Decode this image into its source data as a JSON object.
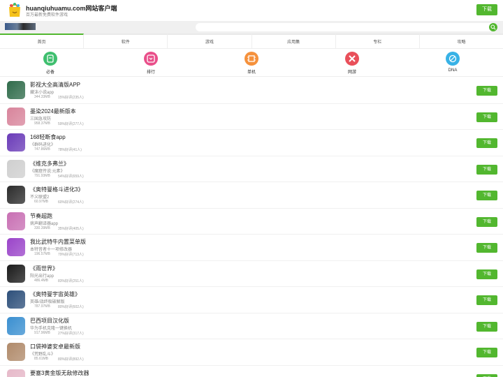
{
  "header": {
    "title": "huanqiuhuamu.com网站客户端",
    "subtitle": "百万最新免费软件游戏",
    "download_label": "下载"
  },
  "search": {
    "placeholder": ""
  },
  "tabs": [
    {
      "label": "首页"
    },
    {
      "label": "软件"
    },
    {
      "label": "游戏"
    },
    {
      "label": "应用集"
    },
    {
      "label": "专栏"
    },
    {
      "label": "攻略"
    }
  ],
  "categories": [
    {
      "label": "必备",
      "icon": "box-icon",
      "color": "#3fbf6f"
    },
    {
      "label": "排行",
      "icon": "rank-icon",
      "color": "#e94f8a"
    },
    {
      "label": "单机",
      "icon": "chip-icon",
      "color": "#f5913c"
    },
    {
      "label": "网游",
      "icon": "cross-icon",
      "color": "#e9505a"
    },
    {
      "label": "DNA",
      "icon": "dna-icon",
      "color": "#38b2e6"
    }
  ],
  "apps": [
    {
      "name": "影视大全高清版APP",
      "desc": "藏沫小说app",
      "size": "344.33MB",
      "rating": "15%好评(235人)",
      "color": "#2f6b4a",
      "download": "下载"
    },
    {
      "name": "墨染2024最新版本",
      "desc": "三国急攻防",
      "size": "958.37MB",
      "rating": "59%好评(277人)",
      "color": "#d8849b",
      "download": "下载"
    },
    {
      "name": "168轻断食app",
      "desc": "《群码进化》",
      "size": "747.86MB",
      "rating": "78%好评(41人)",
      "color": "#6a3bb8",
      "download": "下载"
    },
    {
      "name": "《维克多弗兰》",
      "desc": "《魔窟传说:元素》",
      "size": "791.93MB",
      "rating": "54%好评(659人)",
      "color": "#cfcfcf",
      "download": "下载"
    },
    {
      "name": "《奥特曼格斗进化3》",
      "desc": "不义联盟2",
      "size": "60.97MB",
      "rating": "60%好评(274人)",
      "color": "#2b2b2b",
      "download": "下载"
    },
    {
      "name": "节奏超跑",
      "desc": "病声翻译器app",
      "size": "330.39MB",
      "rating": "35%好评(405人)",
      "color": "#c86fb3",
      "download": "下载"
    },
    {
      "name": "我比武特牛内置菜单版",
      "desc": "本特音者十一项修改器",
      "size": "196.57MB",
      "rating": "79%好评(713人)",
      "color": "#9a44c9",
      "download": "下载"
    },
    {
      "name": "《雨世界》",
      "desc": "阳光出行app",
      "size": "486.4MB",
      "rating": "83%好评(251人)",
      "color": "#1a1a1a",
      "download": "下载"
    },
    {
      "name": "《奥特曼宇宙英雄》",
      "desc": "英雄/战终极破解版",
      "size": "787.97MB",
      "rating": "80%好评(602人)",
      "color": "#2d4f7a",
      "download": "下载"
    },
    {
      "name": "巴西项目汉化版",
      "desc": "华为手机克隆一键换机",
      "size": "917.96MB",
      "rating": "27%好评(317人)",
      "color": "#3a8fd0",
      "download": "下载"
    },
    {
      "name": "口袋神婆安卓最新版",
      "desc": "《荒野乱斗》",
      "size": "85.61MB",
      "rating": "80%好评(892人)",
      "color": "#b08a6a",
      "download": "下载"
    },
    {
      "name": "要塞3黄金版无敌修改器",
      "desc": "",
      "size": "",
      "rating": "",
      "color": "#e6b9c9",
      "download": "下载"
    }
  ]
}
